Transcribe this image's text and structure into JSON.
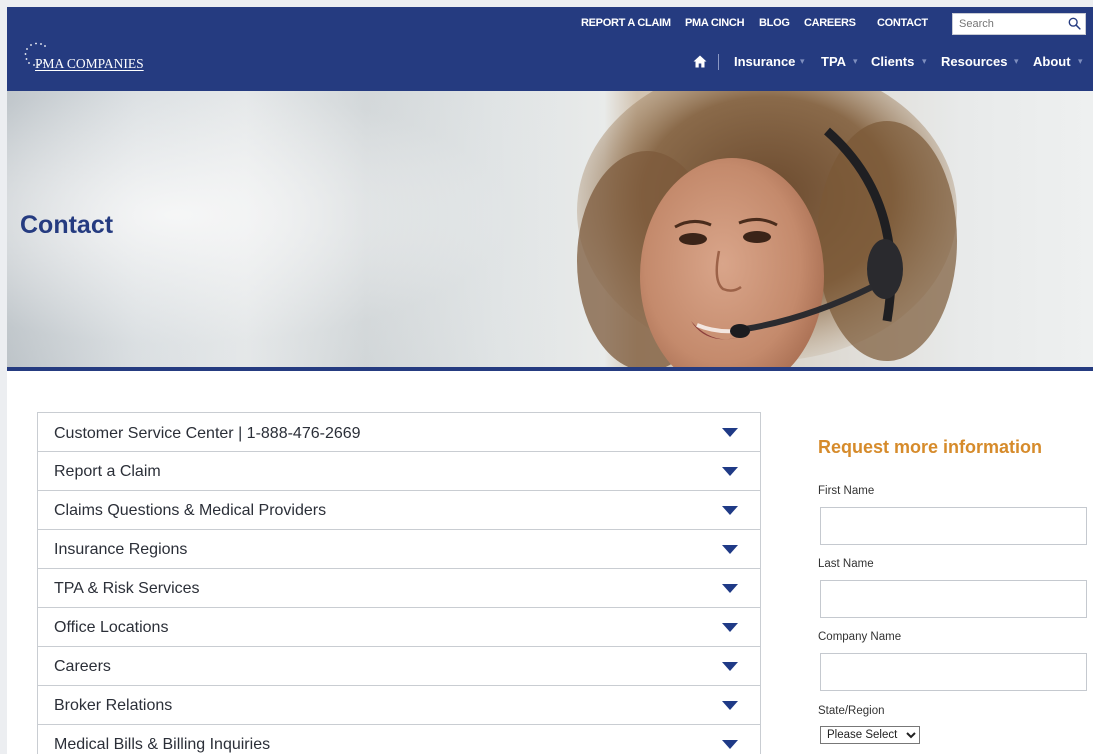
{
  "brand": {
    "logo_text": "PMA COMPANIES"
  },
  "top_links": [
    {
      "label": "REPORT A CLAIM"
    },
    {
      "label": "PMA CINCH"
    },
    {
      "label": "BLOG"
    },
    {
      "label": "CAREERS"
    },
    {
      "label": "CONTACT"
    }
  ],
  "search": {
    "placeholder": "Search",
    "icon": "search-icon"
  },
  "main_nav": [
    {
      "label": "Insurance"
    },
    {
      "label": "TPA"
    },
    {
      "label": "Clients"
    },
    {
      "label": "Resources"
    },
    {
      "label": "About"
    }
  ],
  "home_icon": "home-icon",
  "hero": {
    "title": "Contact"
  },
  "accordion": [
    {
      "label": "Customer Service Center | 1-888-476-2669"
    },
    {
      "label": "Report a Claim"
    },
    {
      "label": "Claims Questions & Medical Providers"
    },
    {
      "label": "Insurance Regions"
    },
    {
      "label": "TPA & Risk Services"
    },
    {
      "label": "Office Locations"
    },
    {
      "label": "Careers"
    },
    {
      "label": "Broker Relations"
    },
    {
      "label": "Medical Bills & Billing Inquiries"
    }
  ],
  "form": {
    "title": "Request more information",
    "first_name_label": "First Name",
    "first_name_value": "",
    "last_name_label": "Last Name",
    "last_name_value": "",
    "company_label": "Company Name",
    "company_value": "",
    "state_label": "State/Region",
    "state_selected": "Please Select"
  },
  "colors": {
    "header_bg": "#253b80",
    "accent_orange": "#d68b2b",
    "title_blue": "#253b80"
  }
}
